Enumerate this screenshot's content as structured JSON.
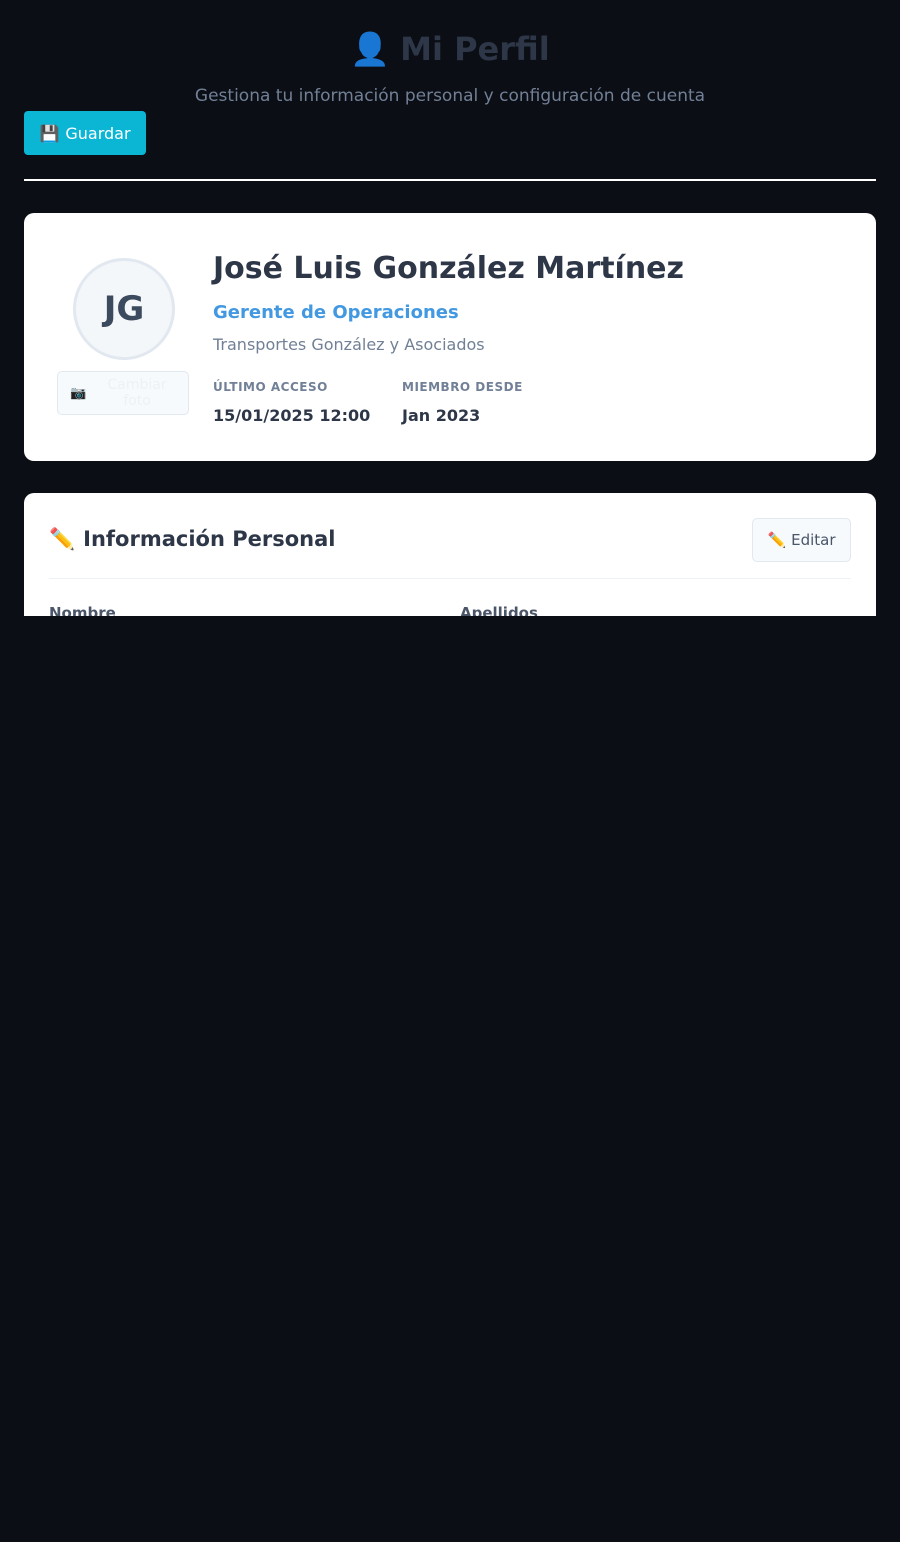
{
  "header": {
    "title_icon": "user-icon",
    "title_icon_glyph": "👤",
    "title": "Mi Perfil",
    "subtitle": "Gestiona tu información personal y configuración de cuenta",
    "save_icon": "floppy-disk-icon",
    "save_icon_glyph": "💾",
    "save_label": "Guardar"
  },
  "profile": {
    "initials": "JG",
    "change_photo_icon": "camera-icon",
    "change_photo_icon_glyph": "📷",
    "change_photo_label": "Cambiar foto",
    "name": "José Luis González Martínez",
    "role": "Gerente de Operaciones",
    "company": "Transportes González y Asociados",
    "last_access_label": "ÚLTIMO ACCESO",
    "last_access_value": "15/01/2025 12:00",
    "member_since_label": "MIEMBRO DESDE",
    "member_since_value": "Jan 2023"
  },
  "personal_info": {
    "title_icon": "pencil-icon",
    "title_icon_glyph": "✏️",
    "title": "Información Personal",
    "edit_icon": "pencil-icon",
    "edit_icon_glyph": "✏️",
    "edit_label": "Editar",
    "first_name_label": "Nombre",
    "last_name_label": "Apellidos"
  },
  "colors": {
    "background": "#0b0e14",
    "accent": "#0bb5d4",
    "role": "#4299e1",
    "card": "#ffffff"
  }
}
